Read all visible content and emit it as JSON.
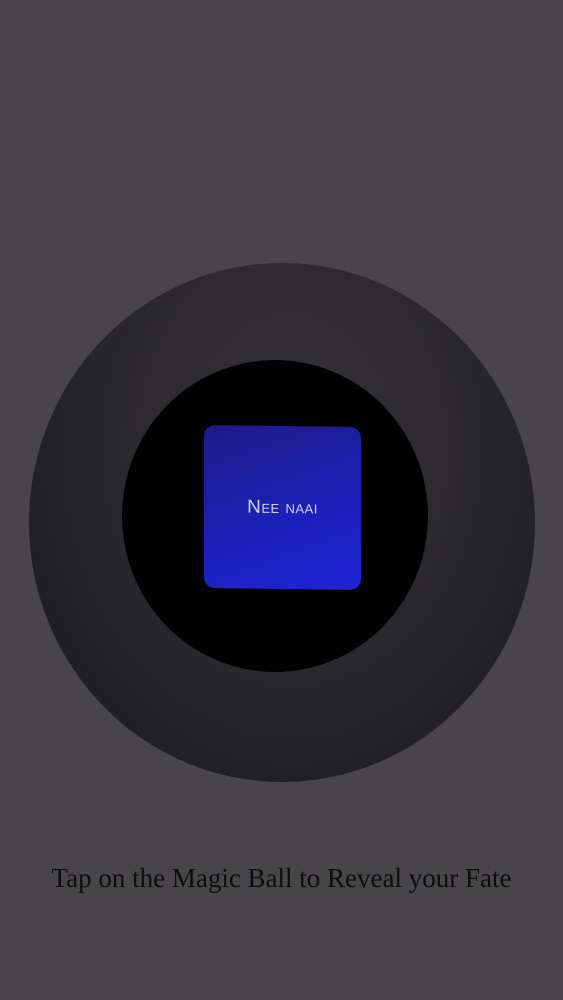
{
  "ball": {
    "answer": "Nee naai"
  },
  "footer": {
    "instruction": "Tap on the Magic Ball to Reveal your Fate"
  },
  "colors": {
    "background": "#474548",
    "ball": "#2c2a2e",
    "window": "#020203",
    "die": "#1c20b8",
    "answer_text": "#d4d6ee",
    "instruction_text": "#0d0d0d"
  }
}
